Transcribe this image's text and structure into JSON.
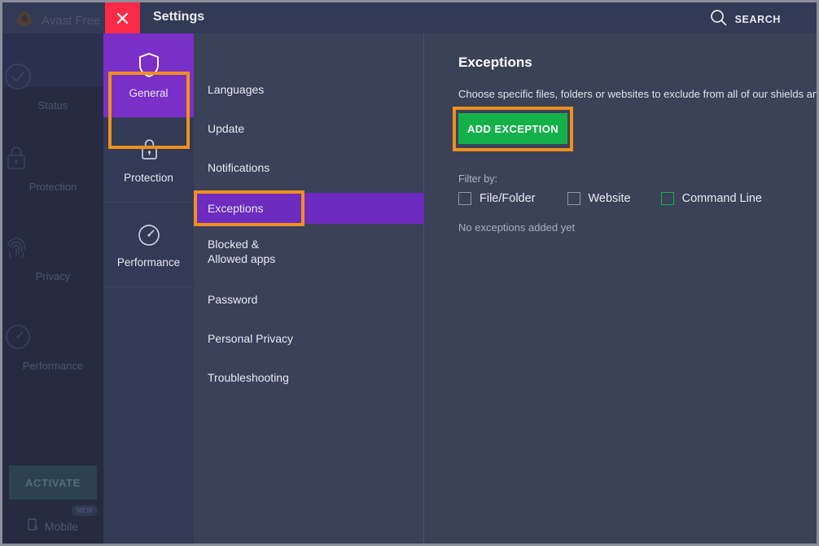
{
  "window": {
    "title": "Settings",
    "close_icon": "close-x-icon",
    "search_label": "SEARCH",
    "search_icon": "search-magnifier-icon"
  },
  "background_app": {
    "logo_icon": "avast-logo-icon",
    "name": "Avast Free A",
    "rail_items": [
      {
        "label": "Status",
        "icon": "check-circle-icon"
      },
      {
        "label": "Protection",
        "icon": "lock-icon"
      },
      {
        "label": "Privacy",
        "icon": "fingerprint-icon"
      },
      {
        "label": "Performance",
        "icon": "speedometer-icon"
      }
    ],
    "activate_label": "ACTIVATE",
    "mobile_label": "Mobile",
    "mobile_icon": "mobile-device-icon",
    "new_badge": "NEW"
  },
  "categories": [
    {
      "label": "General",
      "icon": "shield-icon",
      "active": true
    },
    {
      "label": "Protection",
      "icon": "lock-icon",
      "active": false
    },
    {
      "label": "Performance",
      "icon": "speedometer-icon",
      "active": false
    }
  ],
  "menu": {
    "items": [
      {
        "label": "Languages",
        "active": false
      },
      {
        "label": "Update",
        "active": false
      },
      {
        "label": "Notifications",
        "active": false
      },
      {
        "label": "Exceptions",
        "active": true
      },
      {
        "label": "Blocked & Allowed apps",
        "active": false
      },
      {
        "label": "Password",
        "active": false
      },
      {
        "label": "Personal Privacy",
        "active": false
      },
      {
        "label": "Troubleshooting",
        "active": false
      }
    ]
  },
  "content": {
    "title": "Exceptions",
    "description": "Choose specific files, folders or websites to exclude from all of our shields and scans.",
    "add_button_label": "ADD EXCEPTION",
    "filter_label": "Filter by:",
    "filters": [
      {
        "label": "File/Folder",
        "checked": false,
        "focused": false
      },
      {
        "label": "Website",
        "checked": false,
        "focused": false
      },
      {
        "label": "Command Line",
        "checked": false,
        "focused": true
      }
    ],
    "empty_message": "No exceptions added yet"
  },
  "colors": {
    "accent_purple": "#7a2fc9",
    "highlight_orange": "#f0901f",
    "action_green": "#14b14a",
    "close_red": "#fb2a47",
    "panel_bg": "#3b4257",
    "titlebar_bg": "#333a55"
  }
}
